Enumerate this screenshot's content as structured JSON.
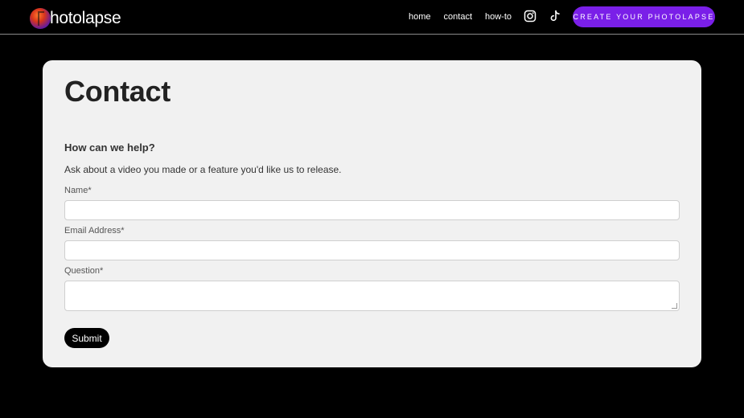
{
  "header": {
    "logo_text": "hotolapse",
    "nav": [
      {
        "label": "home"
      },
      {
        "label": "contact"
      },
      {
        "label": "how-to"
      }
    ],
    "cta_label": "CREATE YOUR PHOTOLAPSE",
    "colors": {
      "cta": "#7a1fe8",
      "background": "#000000"
    }
  },
  "main": {
    "title": "Contact",
    "help_heading": "How can we help?",
    "help_text": "Ask about a video you made or a feature you'd like us to release.",
    "fields": [
      {
        "label": "Name*",
        "value": ""
      },
      {
        "label": "Email Address*",
        "value": ""
      },
      {
        "label": "Question*",
        "value": ""
      }
    ],
    "submit_label": "Submit"
  }
}
